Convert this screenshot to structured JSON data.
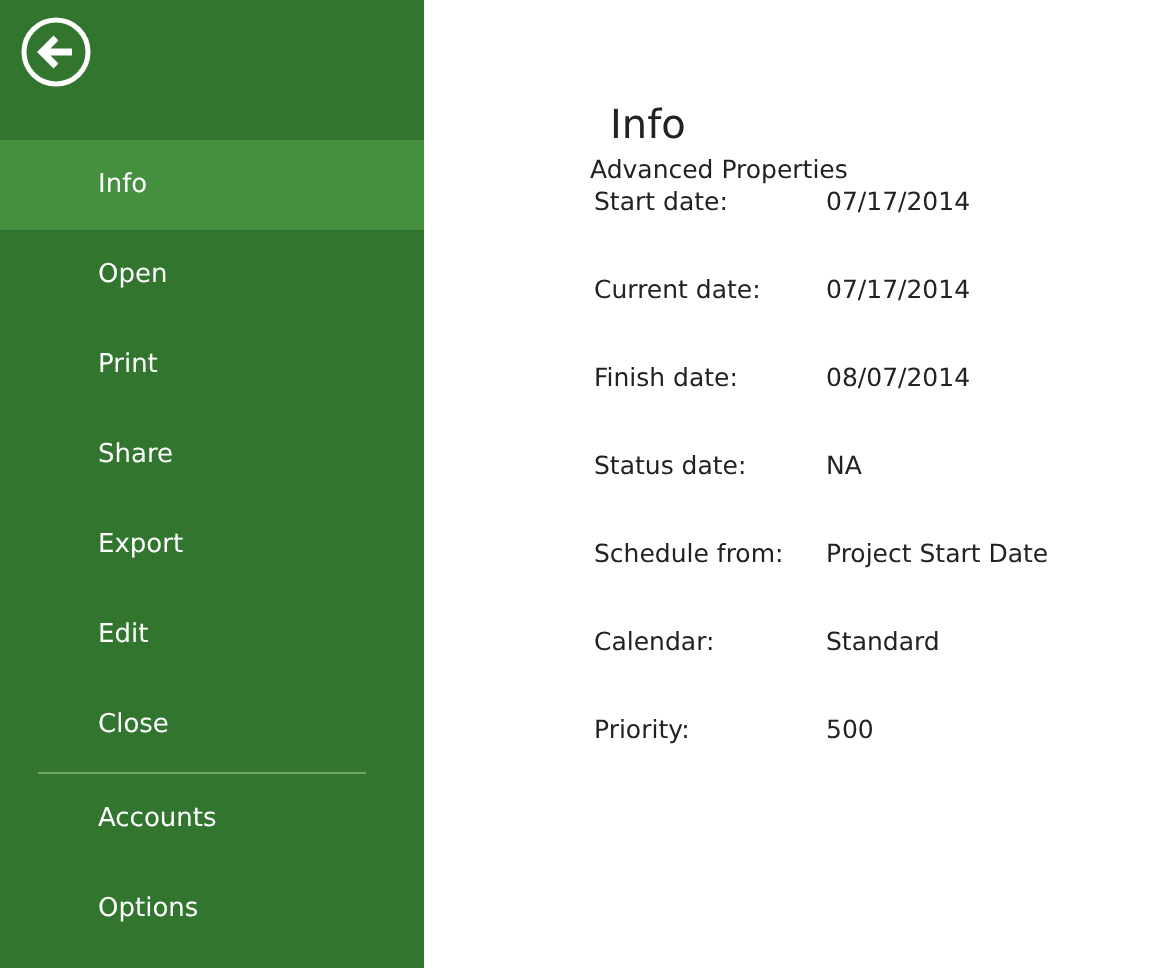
{
  "sidebar": {
    "items": [
      {
        "label": "Info",
        "selected": true
      },
      {
        "label": "Open",
        "selected": false
      },
      {
        "label": "Print",
        "selected": false
      },
      {
        "label": "Share",
        "selected": false
      },
      {
        "label": "Export",
        "selected": false
      },
      {
        "label": "Edit",
        "selected": false
      },
      {
        "label": "Close",
        "selected": false
      }
    ],
    "footer_items": [
      {
        "label": "Accounts",
        "selected": false
      },
      {
        "label": "Options",
        "selected": false
      }
    ]
  },
  "main": {
    "title": "Info",
    "link": "Advanced Properties",
    "properties": [
      {
        "label": "Start date:",
        "value": "07/17/2014"
      },
      {
        "label": "Current date:",
        "value": "07/17/2014"
      },
      {
        "label": "Finish date:",
        "value": "08/07/2014"
      },
      {
        "label": "Status date:",
        "value": "NA"
      },
      {
        "label": "Schedule from:",
        "value": "Project Start Date"
      },
      {
        "label": "Calendar:",
        "value": "Standard"
      },
      {
        "label": "Priority:",
        "value": "500"
      }
    ]
  }
}
